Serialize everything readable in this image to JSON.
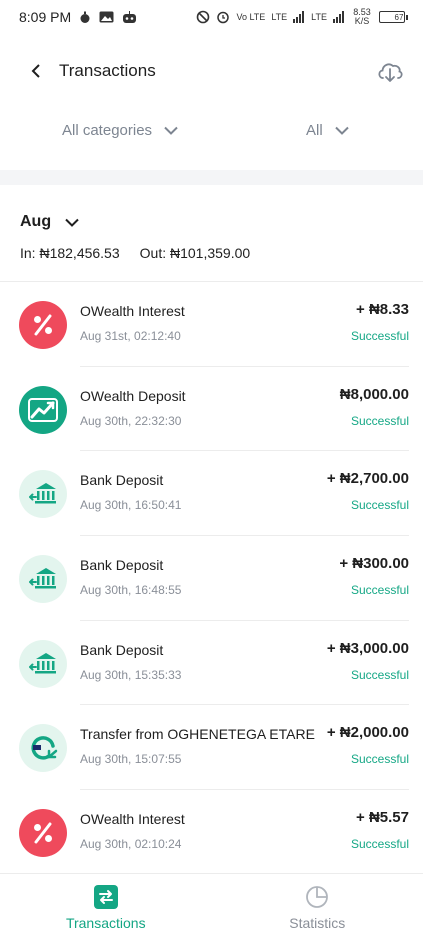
{
  "status_bar": {
    "time": "8:09 PM",
    "network_text": "Vo LTE",
    "lte1": "LTE",
    "lte2": "LTE",
    "speed": "8.53 K/S",
    "battery": "67",
    "battery_level": 0.67
  },
  "header": {
    "title": "Transactions"
  },
  "filters": {
    "category": "All categories",
    "status": "All"
  },
  "month": {
    "label": "Aug",
    "in_text": "In: ₦182,456.53",
    "out_text": "Out: ₦101,359.00"
  },
  "transactions": [
    {
      "name": "OWealth Interest",
      "date": "Aug 31st, 02:12:40",
      "amount": "+ ₦8.33",
      "status": "Successful",
      "icon": "percent-icon"
    },
    {
      "name": "OWealth Deposit",
      "date": "Aug 30th, 22:32:30",
      "amount": "₦8,000.00",
      "status": "Successful",
      "icon": "growth-chart-icon"
    },
    {
      "name": "Bank Deposit",
      "date": "Aug 30th, 16:50:41",
      "amount": "+ ₦2,700.00",
      "status": "Successful",
      "icon": "bank-icon"
    },
    {
      "name": "Bank Deposit",
      "date": "Aug 30th, 16:48:55",
      "amount": "+ ₦300.00",
      "status": "Successful",
      "icon": "bank-icon"
    },
    {
      "name": "Bank Deposit",
      "date": "Aug 30th, 15:35:33",
      "amount": "+ ₦3,000.00",
      "status": "Successful",
      "icon": "bank-icon"
    },
    {
      "name": "Transfer from OGHENETEGA ETARE",
      "date": "Aug 30th, 15:07:55",
      "amount": "+ ₦2,000.00",
      "status": "Successful",
      "icon": "transfer-in-icon"
    },
    {
      "name": "OWealth Interest",
      "date": "Aug 30th, 02:10:24",
      "amount": "+ ₦5.57",
      "status": "Successful",
      "icon": "percent-icon"
    }
  ],
  "bottom_nav": {
    "transactions_label": "Transactions",
    "statistics_label": "Statistics"
  },
  "colors": {
    "accent": "#14a684",
    "interest_red": "#ef4a5c",
    "deposit_mint": "#e3f5ee"
  }
}
